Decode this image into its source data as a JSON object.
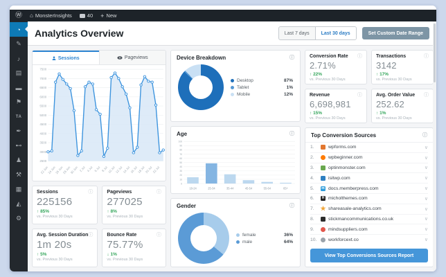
{
  "admin_bar": {
    "site_name": "MonsterInsights",
    "comment_count": "40",
    "new_label": "New"
  },
  "sidebar": {
    "items": [
      {
        "name": "dashboard",
        "glyph": "◔",
        "active": true
      },
      {
        "name": "posts",
        "glyph": "✎"
      },
      {
        "name": "media",
        "glyph": "♪"
      },
      {
        "name": "pages",
        "glyph": "▤"
      },
      {
        "name": "comments",
        "glyph": "▬"
      },
      {
        "name": "feedback",
        "glyph": "⚑"
      },
      {
        "name": "text-tool",
        "glyph": "TA"
      },
      {
        "name": "appearance",
        "glyph": "✒"
      },
      {
        "name": "plugins",
        "glyph": "⊷"
      },
      {
        "name": "users",
        "glyph": "♟"
      },
      {
        "name": "tools",
        "glyph": "⚒"
      },
      {
        "name": "settings",
        "glyph": "▦"
      },
      {
        "name": "insights",
        "glyph": "◭"
      },
      {
        "name": "options",
        "glyph": "⚙"
      }
    ]
  },
  "header": {
    "title": "Analytics Overview",
    "range_buttons": [
      {
        "label": "Last 7 days",
        "active": false
      },
      {
        "label": "Last 30 days",
        "active": true
      }
    ],
    "custom_range_label": "Set Custom Date Range"
  },
  "traffic_panel": {
    "tabs": [
      {
        "label": "Sessions",
        "active": true
      },
      {
        "label": "Pageviews",
        "active": false
      }
    ]
  },
  "chart_data": [
    {
      "type": "area",
      "title": "Sessions over time",
      "ylabel": "Sessions",
      "ylim": [
        2500,
        7500
      ],
      "ytick": 500,
      "grid": true,
      "line_color": "#3d94de",
      "fill_color": "#d8e8f7",
      "x_labels": [
        "22 Jun",
        "24 Jun",
        "26 Jun",
        "28 Jun",
        "30 Jun",
        "2 Jul",
        "4 Jul",
        "6 Jul",
        "8 Jul",
        "10 Jul",
        "12 Jul",
        "14 Jul",
        "16 Jul",
        "18 Jul",
        "20 Jul",
        "22 Jul"
      ],
      "values": [
        3000,
        3050,
        6800,
        7250,
        6950,
        6700,
        6450,
        5250,
        2800,
        3050,
        6550,
        6800,
        6700,
        5300,
        5050,
        2750,
        3200,
        7050,
        7300,
        7000,
        6550,
        6150,
        5400,
        2950,
        3250,
        6650,
        7100,
        6850,
        6800,
        5550,
        2950,
        3100
      ]
    },
    {
      "type": "pie",
      "title": "Device Breakdown",
      "labels": [
        "Desktop",
        "Tablet",
        "Mobile"
      ],
      "values": [
        87,
        1,
        12
      ],
      "value_labels": [
        "87%",
        "1%",
        "12%"
      ],
      "colors": [
        "#1e6fba",
        "#5598d4",
        "#c9e0f4"
      ],
      "legend_position": "right"
    },
    {
      "type": "bar",
      "title": "Age",
      "categories": [
        "18-24",
        "25-34",
        "35-44",
        "45-54",
        "55-64",
        "65+"
      ],
      "values": [
        15,
        48,
        22,
        8,
        4,
        2
      ],
      "ylim": [
        0,
        100
      ],
      "ytick": 10,
      "grid": true,
      "bar_color": "#bcd8ef",
      "highlight_index": 1,
      "highlight_color": "#84b5e2"
    },
    {
      "type": "pie",
      "title": "Gender",
      "labels": [
        "female",
        "male"
      ],
      "values": [
        36,
        64
      ],
      "value_labels": [
        "36%",
        "64%"
      ],
      "colors": [
        "#a7cceb",
        "#5b9bd6"
      ],
      "legend_position": "right"
    }
  ],
  "stats_left": [
    {
      "title": "Sessions",
      "value": "225156",
      "arrow": "↑",
      "change": "85%",
      "sub": "vs. Previous 30 Days"
    },
    {
      "title": "Pageviews",
      "value": "277025",
      "arrow": "↑",
      "change": "8%",
      "sub": "vs. Previous 30 Days"
    },
    {
      "title": "Avg. Session Duration",
      "value": "1m 20s",
      "arrow": "↑",
      "change": "5%",
      "sub": "vs. Previous 30 Days"
    },
    {
      "title": "Bounce Rate",
      "value": "75.77%",
      "arrow": "↓",
      "change": "1%",
      "sub": "vs. Previous 30 Days"
    }
  ],
  "stats_right": [
    {
      "title": "Conversion Rate",
      "value": "2.71%",
      "arrow": "↑",
      "change": "22%",
      "sub": "vs. Previous 30 Days"
    },
    {
      "title": "Transactions",
      "value": "3142",
      "arrow": "↑",
      "change": "17%",
      "sub": "vs. Previous 30 Days"
    },
    {
      "title": "Revenue",
      "value": "6,698,981",
      "arrow": "↑",
      "change": "15%",
      "sub": "vs. Previous 30 Days"
    },
    {
      "title": "Avg. Order Value",
      "value": "252.62",
      "arrow": "↑",
      "change": "1%",
      "sub": "vs. Previous 30 Days"
    }
  ],
  "sources": {
    "title": "Top Conversion Sources",
    "items": [
      {
        "rank": "1.",
        "domain": "wpforms.com",
        "icon_bg": "#e27730",
        "icon_glyph": "",
        "round": false
      },
      {
        "rank": "2.",
        "domain": "wpbeginner.com",
        "icon_bg": "#ff7b00",
        "icon_glyph": "",
        "round": true
      },
      {
        "rank": "3.",
        "domain": "optinmonster.com",
        "icon_bg": "#69a74e",
        "icon_glyph": "",
        "round": false
      },
      {
        "rank": "4.",
        "domain": "isitwp.com",
        "icon_bg": "#2d7fc1",
        "icon_glyph": "",
        "round": false
      },
      {
        "rank": "5.",
        "domain": "docs.memberpress.com",
        "icon_bg": "#2d9cdb",
        "icon_glyph": "m",
        "round": false
      },
      {
        "rank": "6.",
        "domain": "micholthemes.com",
        "icon_bg": "#222222",
        "icon_glyph": "H",
        "round": false
      },
      {
        "rank": "7.",
        "domain": "shareasale-analytics.com",
        "icon_bg": "transparent",
        "icon_glyph": "★",
        "icon_color": "#f0a63a",
        "round": false
      },
      {
        "rank": "8.",
        "domain": "stickmancommunications.co.uk",
        "icon_bg": "#2b2b2b",
        "icon_glyph": "",
        "round": false
      },
      {
        "rank": "9.",
        "domain": "mindsuppliers.com",
        "icon_bg": "#e2574c",
        "icon_glyph": "",
        "round": true
      },
      {
        "rank": "10.",
        "domain": "workforcext.co",
        "icon_bg": "#9aa3ab",
        "icon_glyph": "",
        "round": true
      }
    ],
    "button_label": "View Top Conversions Sources Report"
  }
}
